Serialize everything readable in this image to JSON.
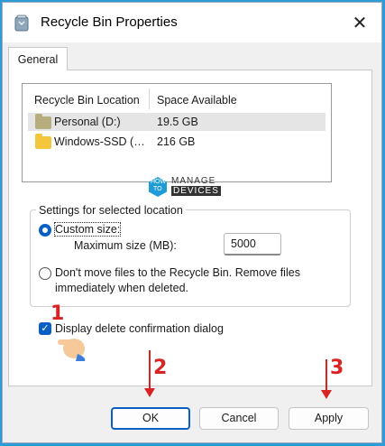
{
  "window": {
    "title": "Recycle Bin Properties",
    "close_glyph": "✕"
  },
  "tabs": [
    {
      "label": "General"
    }
  ],
  "list": {
    "headers": [
      "Recycle Bin Location",
      "Space Available"
    ],
    "rows": [
      {
        "name": "Personal (D:)",
        "space": "19.5 GB",
        "icon": "drive-folder-icon",
        "selected": true
      },
      {
        "name": "Windows-SSD (…",
        "space": "216 GB",
        "icon": "folder-icon",
        "selected": false
      }
    ]
  },
  "watermark": {
    "line1a": "HOW",
    "line1b": "TO",
    "line2a": "MANAGE",
    "line2b": "DEVICES"
  },
  "settings": {
    "group_label": "Settings for selected location",
    "custom_size_label": "Custom size:",
    "max_size_label": "Maximum size (MB):",
    "max_size_value": "5000",
    "dont_move_label": "Don't move files to the Recycle Bin. Remove files immediately when deleted.",
    "custom_selected": true
  },
  "confirmation": {
    "label": "Display delete confirmation dialog",
    "checked": true
  },
  "annotations": {
    "step1": "1",
    "step2": "2",
    "step3": "3"
  },
  "buttons": {
    "ok": "OK",
    "cancel": "Cancel",
    "apply": "Apply"
  },
  "colors": {
    "accent": "#0a5fc4",
    "annotation": "#d92323",
    "background": "#2e9bd6"
  }
}
